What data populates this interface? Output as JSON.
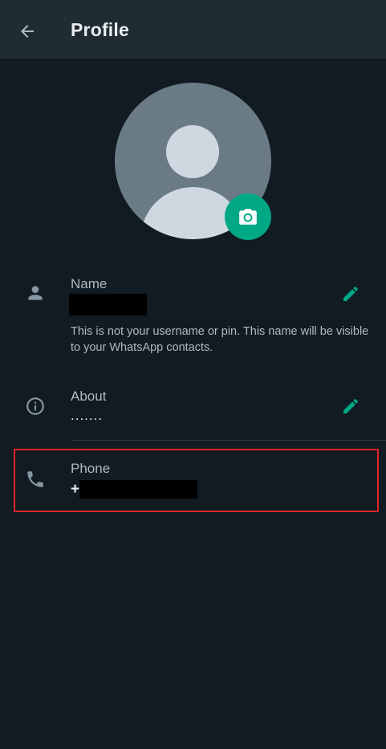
{
  "appbar": {
    "title": "Profile",
    "back_icon": "arrow-back-icon"
  },
  "avatar": {
    "camera_icon": "camera-icon"
  },
  "name": {
    "label": "Name",
    "value_redacted": true,
    "hint": "This is not your username or pin. This name will be visible to your WhatsApp contacts.",
    "icon": "person-icon",
    "edit_icon": "pencil-icon"
  },
  "about": {
    "label": "About",
    "value": ".......",
    "icon": "info-icon",
    "edit_icon": "pencil-icon"
  },
  "phone": {
    "label": "Phone",
    "value_prefix": "+",
    "value_redacted": true,
    "icon": "phone-icon"
  },
  "colors": {
    "background": "#111b21",
    "appbar": "#1f2c34",
    "accent": "#00a884",
    "highlight_border": "#e0232b",
    "avatar_bg": "#6a7b86"
  }
}
